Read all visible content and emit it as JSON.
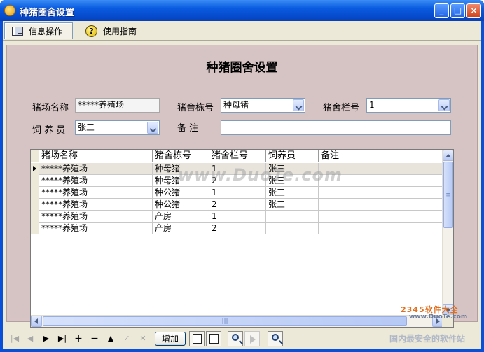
{
  "window": {
    "title": "种猪圈舍设置",
    "min": "_",
    "max": "□",
    "close": "×"
  },
  "tabs": [
    {
      "label": "信息操作",
      "icon": "document-list-icon",
      "active": true
    },
    {
      "label": "使用指南",
      "icon": "help-icon",
      "active": false
    }
  ],
  "form": {
    "title": "种猪圈舍设置",
    "farm_name_label": "猪场名称",
    "farm_name_value": "*****养殖场",
    "building_label": "猪舍栋号",
    "building_value": "种母猪",
    "pen_label": "猪舍栏号",
    "pen_value": "1",
    "keeper_label": "饲 养 员",
    "keeper_value": "张三",
    "remark_label": "备    注",
    "remark_value": ""
  },
  "grid": {
    "columns": [
      "猪场名称",
      "猪舍栋号",
      "猪舍栏号",
      "饲养员",
      "备注"
    ],
    "rows": [
      [
        "*****养殖场",
        "种母猪",
        "1",
        "张三",
        ""
      ],
      [
        "*****养殖场",
        "种母猪",
        "2",
        "张三",
        ""
      ],
      [
        "*****养殖场",
        "种公猪",
        "1",
        "张三",
        ""
      ],
      [
        "*****养殖场",
        "种公猪",
        "2",
        "张三",
        ""
      ],
      [
        "*****养殖场",
        "产房",
        "1",
        "",
        ""
      ],
      [
        "*****养殖场",
        "产房",
        "2",
        "",
        ""
      ]
    ],
    "selected_row": 0,
    "hscroll_grip": "|||",
    "vscroll_grip": "≡"
  },
  "toolbar": {
    "first": "|◀",
    "prev": "◀",
    "next": "▶",
    "last": "▶|",
    "insert": "+",
    "delete": "−",
    "edit": "▲",
    "post": "✓",
    "cancel": "✕",
    "add_label": "增加"
  },
  "watermark": {
    "duote": "www.DuoTe.com",
    "site_num": "2345软件大全",
    "site_url": "www.DuoTe.com",
    "slogan": "国内最安全的软件站"
  }
}
